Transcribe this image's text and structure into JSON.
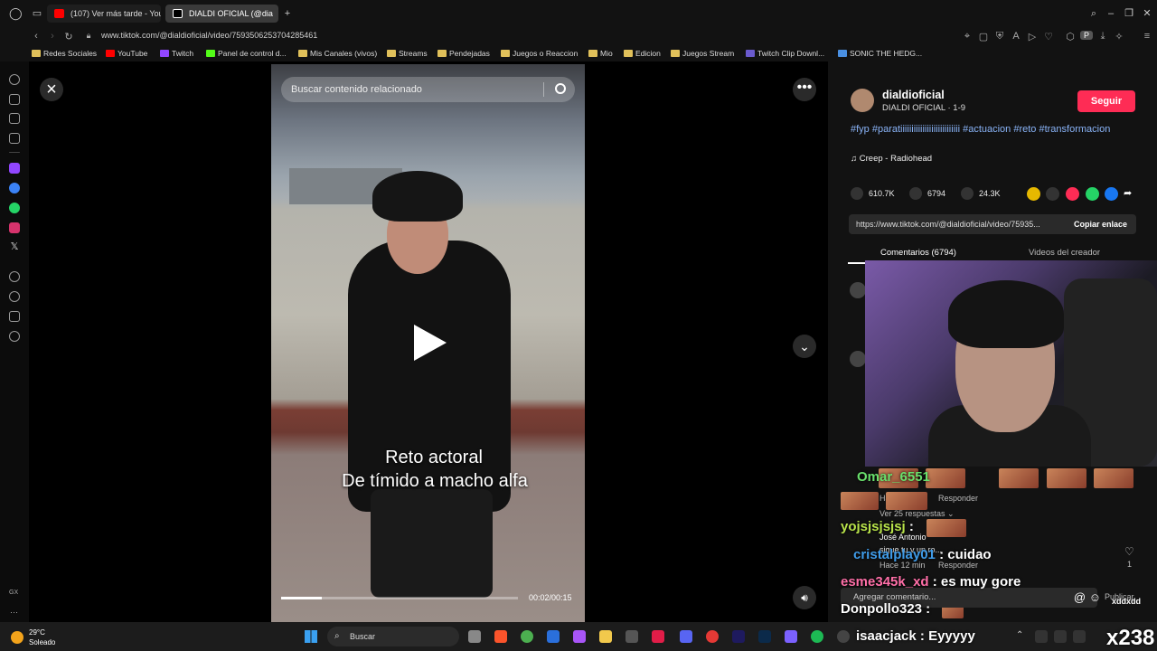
{
  "browser": {
    "tabs": [
      {
        "label": "(107) Ver más tarde - YouT",
        "color": "#ff0000"
      },
      {
        "label": "DIALDI OFICIAL (@dia",
        "color": "#ffffff"
      }
    ],
    "new_tab": "+",
    "url": "www.tiktok.com/@dialdioficial/video/7593506253704285461"
  },
  "bookmarks": [
    {
      "label": "Redes Sociales",
      "color": "#e0c05a"
    },
    {
      "label": "YouTube",
      "color": "#ff0000"
    },
    {
      "label": "Twitch",
      "color": "#9146ff"
    },
    {
      "label": "Panel de control d...",
      "color": "#53fc18"
    },
    {
      "label": "Mis Canales (vivos)",
      "color": "#e0c05a"
    },
    {
      "label": "Streams",
      "color": "#e0c05a"
    },
    {
      "label": "Pendejadas",
      "color": "#e0c05a"
    },
    {
      "label": "Juegos o Reaccion",
      "color": "#e0c05a"
    },
    {
      "label": "Mio",
      "color": "#e0c05a"
    },
    {
      "label": "Edicion",
      "color": "#e0c05a"
    },
    {
      "label": "Juegos Stream",
      "color": "#e0c05a"
    },
    {
      "label": "Twitch Clip Downl...",
      "color": "#6a5acd"
    },
    {
      "label": "SONIC THE HEDG...",
      "color": "#4a90e2"
    }
  ],
  "video": {
    "search_placeholder": "Buscar contenido relacionado",
    "caption_line1": "Reto actoral",
    "caption_line2": "De tímido a macho alfa",
    "time": "00:02/00:15",
    "progress": 0.17
  },
  "creator": {
    "username": "dialdioficial",
    "subtitle": "DIALDI OFICIAL · 1-9",
    "follow_label": "Seguir",
    "hashtags": "#fyp #paratiiiiiiiiiiiiiiiiiiiiiiiiiii #actuacion #reto #transformacion",
    "music": "Creep - Radiohead",
    "music_icon": "♫"
  },
  "stats": {
    "likes": "610.7K",
    "comments": "6794",
    "saves": "24.3K"
  },
  "link": {
    "url": "https://www.tiktok.com/@dialdioficial/video/75935...",
    "copy_label": "Copiar enlace"
  },
  "tabs": {
    "comments": "Comentarios (6794)",
    "creator_videos": "Videos del creador"
  },
  "comments": {
    "reply1": "Responder",
    "view_replies": "Ver 25 respuestas ⌄",
    "author2": "José Antonio",
    "text2": "sigue tu v un ro...",
    "time2": "Hace 12 min",
    "reply2": "Responder",
    "like_count": "1",
    "input_placeholder": "Agregar comentario...",
    "post_label": "Publicar",
    "h_fragment": "Ha"
  },
  "chat": [
    {
      "user": "Omar_6551",
      "msg": "",
      "color": "#69e06c"
    },
    {
      "user": "yojsjsjsjsj",
      "msg": " :",
      "color": "#b8e34a"
    },
    {
      "user": "cristalplay01",
      "msg": " : cuidao",
      "color": "#3f9be8"
    },
    {
      "user": "esme345k_xd",
      "msg": " : es muy gore",
      "color": "#ff6fa8"
    },
    {
      "user": "Donpollo323",
      "msg": " :",
      "color": "#ffffff"
    },
    {
      "user": "isaacjack",
      "msg": " : Eyyyyy",
      "color": "#ffffff"
    }
  ],
  "overlay": {
    "badge": "x238",
    "emote_label": "xddxdd"
  },
  "taskbar": {
    "temp": "29°C",
    "weather": "Soleado",
    "search": "Buscar"
  }
}
